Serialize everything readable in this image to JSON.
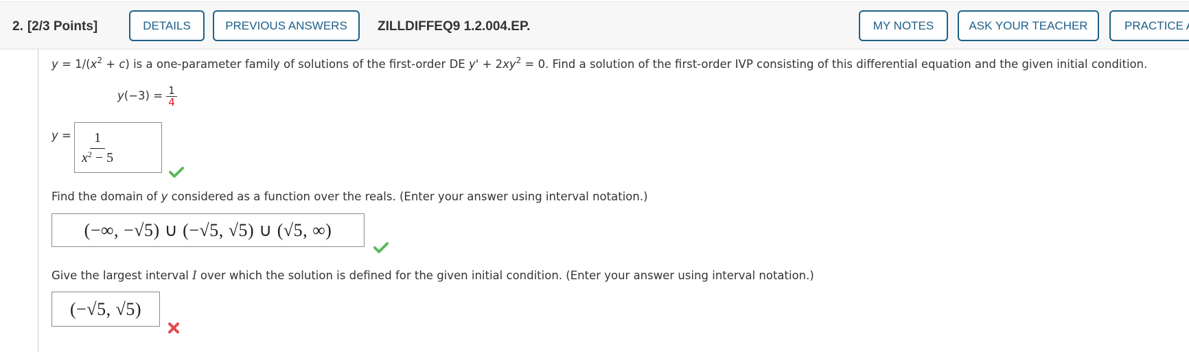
{
  "header": {
    "question_number": "2.",
    "points": "[2/3 Points]",
    "buttons": {
      "details": "DETAILS",
      "previous_answers": "PREVIOUS ANSWERS",
      "my_notes": "MY NOTES",
      "ask_teacher": "ASK YOUR TEACHER",
      "practice": "PRACTICE ANOTHER"
    },
    "question_id": "ZILLDIFFEQ9 1.2.004.EP."
  },
  "problem": {
    "intro_y": "y",
    "intro_eq": " = 1/(",
    "intro_x": "x",
    "intro_exp": "2",
    "intro_plus": " + ",
    "intro_c": "c",
    "intro_rest1": ") is a one-parameter family of solutions of the first-order DE ",
    "intro_yprime": "y'",
    "intro_plus2": " + 2",
    "intro_xy": "xy",
    "intro_exp2": "2",
    "intro_rest2": " = 0. Find a solution of the first-order IVP consisting of this differential equation and the given initial condition.",
    "initial_condition_lhs": "y",
    "initial_condition_arg": "(−3) = ",
    "initial_condition_num": "1",
    "initial_condition_den": "4"
  },
  "part1": {
    "label_y": "y",
    "label_eq": " =",
    "answer_num": "1",
    "answer_den_x": "x",
    "answer_den_exp": "2",
    "answer_den_rest": " − 5",
    "status": "correct"
  },
  "part2": {
    "prompt_a": "Find the domain of ",
    "prompt_y": "y",
    "prompt_b": " considered as a function over the reals. (Enter your answer using interval notation.)",
    "answer": "(−∞, −√5) ∪ (−√5, √5) ∪ (√5, ∞)",
    "status": "correct"
  },
  "part3": {
    "prompt_a": "Give the largest interval ",
    "prompt_i": "I",
    "prompt_b": " over which the solution is defined for the given initial condition. (Enter your answer using interval notation.)",
    "answer": "(−√5, √5)",
    "status": "incorrect"
  },
  "colors": {
    "accent": "#1d5f8a",
    "correct": "#5cb85c",
    "incorrect": "#e8474f",
    "denominator_red": "#e31b1b"
  }
}
